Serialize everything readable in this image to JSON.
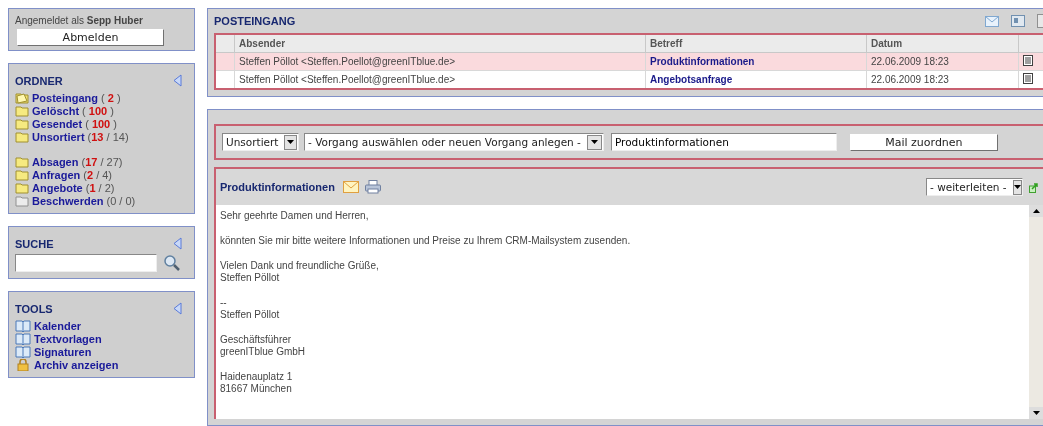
{
  "session": {
    "label": "Angemeldet als",
    "user": "Sepp Huber",
    "logout": "Abmelden"
  },
  "folders": {
    "title": "ORDNER",
    "groups": [
      [
        {
          "name": "Posteingang",
          "kind": "inbox",
          "count": "( **2** )"
        },
        {
          "name": "Gelöscht",
          "kind": "folder",
          "count": "( **100** )"
        },
        {
          "name": "Gesendet",
          "kind": "folder",
          "count": "( **100** )"
        },
        {
          "name": "Unsortiert",
          "kind": "folder",
          "count": "(**13** / 14)"
        }
      ],
      [
        {
          "name": "Absagen",
          "kind": "folder",
          "count": "(**17** / 27)"
        },
        {
          "name": "Anfragen",
          "kind": "folder",
          "count": "(**2** / 4)"
        },
        {
          "name": "Angebote",
          "kind": "folder",
          "count": "(**1** / 2)"
        },
        {
          "name": "Beschwerden",
          "kind": "empty",
          "count": "(0 / 0)"
        }
      ]
    ]
  },
  "search": {
    "title": "SUCHE"
  },
  "tools": {
    "title": "TOOLS",
    "items": [
      {
        "label": "Kalender",
        "kind": "book"
      },
      {
        "label": "Textvorlagen",
        "kind": "book"
      },
      {
        "label": "Signaturen",
        "kind": "book"
      },
      {
        "label": "Archiv anzeigen",
        "kind": "lock"
      }
    ]
  },
  "inbox": {
    "title": "POSTEINGANG",
    "columns": [
      "Absender",
      "Betreff",
      "Datum"
    ],
    "rows": [
      {
        "sender": "Steffen Pöllot <Steffen.Poellot@greenITblue.de>",
        "subject": "Produktinformationen",
        "date": "22.06.2009 18:23",
        "selected": true
      },
      {
        "sender": "Steffen Pöllot <Steffen.Poellot@greenITblue.de>",
        "subject": "Angebotsanfrage",
        "date": "22.06.2009 18:23",
        "selected": false
      }
    ]
  },
  "assign": {
    "folder": "Unsortiert",
    "process": "- Vorgang auswählen oder neuen Vorgang anlegen -",
    "subject": "Produktinformationen",
    "button": "Mail zuordnen"
  },
  "message": {
    "title": "Produktinformationen",
    "forward": "- weiterleiten -",
    "paragraphs": [
      "Sehr geehrte Damen und Herren,",
      "könnten Sie mir bitte weitere Informationen und Preise zu Ihrem CRM-Mailsystem zusenden.",
      "Vielen Dank und freundliche Grüße,\nSteffen Pöllot",
      "--\nSteffen Pöllot",
      "Geschäftsführer\ngreenITblue GmbH",
      "Haidenauplatz 1\n81667 München"
    ]
  }
}
